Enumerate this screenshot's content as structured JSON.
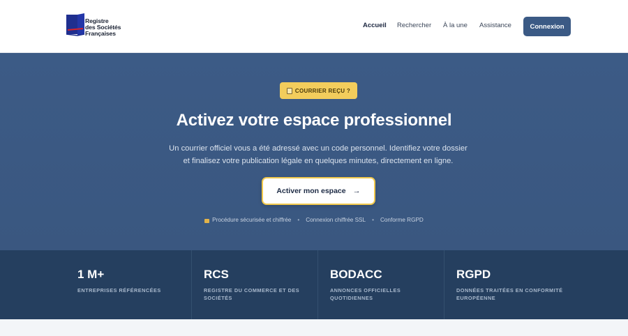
{
  "header": {
    "logo_lines": [
      "Registre",
      "des Sociétés",
      "Françaises"
    ],
    "nav": [
      {
        "label": "Accueil",
        "active": true
      },
      {
        "label": "Rechercher",
        "active": false
      },
      {
        "label": "À la une",
        "active": false
      },
      {
        "label": "Assistance",
        "active": false
      }
    ],
    "login_label": "Connexion"
  },
  "hero": {
    "badge": "COURRIER REÇU ?",
    "title": "Activez votre espace professionnel",
    "subtitle_line1": "Un courrier officiel vous a été adressé avec un code personnel. Identifiez votre dossier",
    "subtitle_line2": "et finalisez votre publication légale en quelques minutes, directement en ligne.",
    "cta_label": "Activer mon espace",
    "trust": [
      "Procédure sécurisée et chiffrée",
      "Connexion chiffrée SSL",
      "Conforme RGPD"
    ]
  },
  "stats": [
    {
      "value": "1 M+",
      "label": "ENTREPRISES RÉFÉRENCÉES"
    },
    {
      "value": "RCS",
      "label": "REGISTRE DU COMMERCE ET DES SOCIÉTÉS"
    },
    {
      "value": "BODACC",
      "label": "ANNONCES OFFICIELLES QUOTIDIENNES"
    },
    {
      "value": "RGPD",
      "label": "DONNÉES TRAITÉES EN CONFORMITÉ EUROPÉENNE"
    }
  ],
  "colors": {
    "primary": "#3b5a85",
    "accent": "#f2c94c",
    "stats_bg": "#253f5f"
  },
  "icons": {
    "badge": "envelope-icon",
    "cta": "arrow-right-icon",
    "trust": "lock-icon"
  }
}
